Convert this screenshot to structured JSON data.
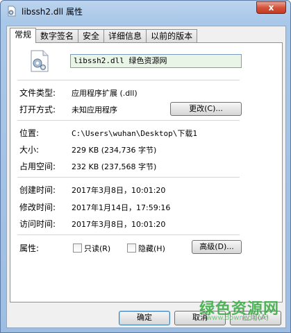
{
  "window": {
    "title": "libssh2.dll 属性",
    "close_label": "x"
  },
  "tabs": [
    {
      "label": "常规",
      "active": true
    },
    {
      "label": "数字签名",
      "active": false
    },
    {
      "label": "安全",
      "active": false
    },
    {
      "label": "详细信息",
      "active": false
    },
    {
      "label": "以前的版本",
      "active": false
    }
  ],
  "general": {
    "file_name": "libssh2.dll  绿色资源网",
    "file_type_label": "文件类型:",
    "file_type_value": "应用程序扩展 (.dll)",
    "open_with_label": "打开方式:",
    "open_with_value": "未知应用程序",
    "change_button": "更改(C)...",
    "location_label": "位置:",
    "location_value": "C:\\Users\\wuhan\\Desktop\\下载1",
    "size_label": "大小:",
    "size_value": "229 KB (234,736 字节)",
    "disk_size_label": "占用空间:",
    "disk_size_value": "232 KB (237,568 字节)",
    "created_label": "创建时间:",
    "created_value": "2017年3月8日，10:01:20",
    "modified_label": "修改时间:",
    "modified_value": "2017年1月14日，17:59:16",
    "accessed_label": "访问时间:",
    "accessed_value": "2017年3月8日，10:01:20",
    "attributes_label": "属性:",
    "readonly_label": "只读(R)",
    "hidden_label": "隐藏(H)",
    "advanced_button": "高级(D)..."
  },
  "footer": {
    "ok_button": "确定",
    "cancel_button": "取消",
    "apply_button": "应用(A)"
  },
  "watermark": {
    "text": "绿色资源网",
    "url": "www.downcc.com"
  },
  "colors": {
    "title_bar": "#a9c7e8",
    "close_button": "#c13a20",
    "name_box_bg": "#e9f5e7",
    "watermark": "#3fae49"
  }
}
